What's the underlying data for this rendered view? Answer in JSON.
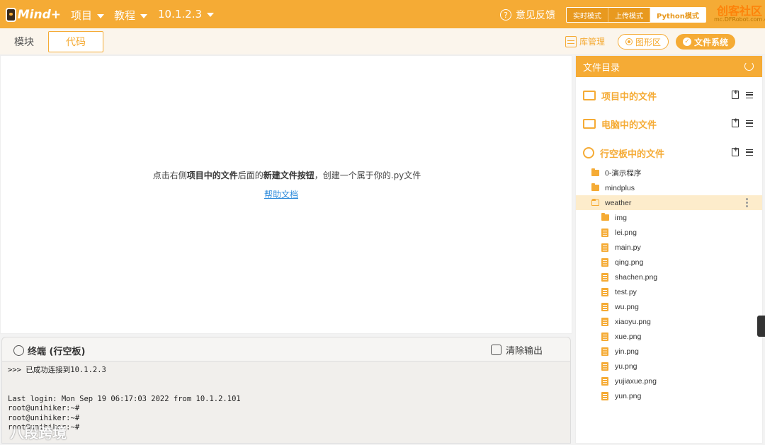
{
  "app": {
    "logo_text": "Mind+",
    "menus": [
      {
        "label": "项目"
      },
      {
        "label": "教程"
      },
      {
        "label": "10.1.2.3"
      }
    ],
    "feedback_label": "意见反馈",
    "modes": [
      "实时模式",
      "上传模式",
      "Python模式"
    ],
    "active_mode": "Python模式",
    "brand": "创客社区",
    "brand_sub": "mc.DFRobot.com.cn"
  },
  "tabs": {
    "blocks": "模块",
    "code": "代码",
    "active": "代码"
  },
  "toolbar": {
    "library": "库管理",
    "graphics": "图形区",
    "filesystem": "文件系统"
  },
  "editor": {
    "hint_pre": "点击右侧",
    "hint_bold1": "项目中的文件",
    "hint_mid": "后面的",
    "hint_bold2": "新建文件按钮",
    "hint_post": "，创建一个属于你的.py文件",
    "help_link": "帮助文档"
  },
  "terminal": {
    "title": "终端 (行空板)",
    "clear_label": "清除输出",
    "output": ">>> 已成功连接到10.1.2.3\n\n\nLast login: Mon Sep 19 06:17:03 2022 from 10.1.2.101\nroot@unihiker:~#\nroot@unihiker:~#\nroot@unihiker:~#"
  },
  "file_panel": {
    "title": "文件目录",
    "sections": [
      {
        "label": "项目中的文件",
        "icon": "list-icon"
      },
      {
        "label": "电脑中的文件",
        "icon": "monitor-icon"
      },
      {
        "label": "行空板中的文件",
        "icon": "board-icon"
      }
    ],
    "tree": [
      {
        "name": "0-演示程序",
        "type": "folder",
        "depth": 0
      },
      {
        "name": "mindplus",
        "type": "folder",
        "depth": 0
      },
      {
        "name": "weather",
        "type": "folder-open",
        "depth": 0,
        "selected": true
      },
      {
        "name": "img",
        "type": "folder",
        "depth": 1
      },
      {
        "name": "lei.png",
        "type": "file",
        "depth": 1
      },
      {
        "name": "main.py",
        "type": "file",
        "depth": 1
      },
      {
        "name": "qing.png",
        "type": "file",
        "depth": 1
      },
      {
        "name": "shachen.png",
        "type": "file",
        "depth": 1
      },
      {
        "name": "test.py",
        "type": "file",
        "depth": 1
      },
      {
        "name": "wu.png",
        "type": "file",
        "depth": 1
      },
      {
        "name": "xiaoyu.png",
        "type": "file",
        "depth": 1
      },
      {
        "name": "xue.png",
        "type": "file",
        "depth": 1
      },
      {
        "name": "yin.png",
        "type": "file",
        "depth": 1
      },
      {
        "name": "yu.png",
        "type": "file",
        "depth": 1
      },
      {
        "name": "yujiaxue.png",
        "type": "file",
        "depth": 1
      },
      {
        "name": "yun.png",
        "type": "file",
        "depth": 1
      }
    ]
  },
  "watermark": "八段跨境",
  "colors": {
    "accent": "#f5ab35",
    "link": "#2f8cdc",
    "selected_row": "#fdeccb"
  }
}
